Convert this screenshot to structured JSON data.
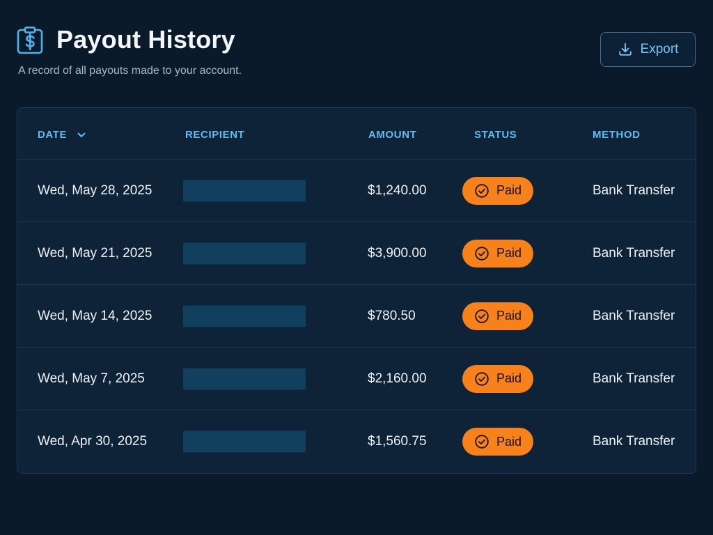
{
  "header": {
    "title": "Payout History",
    "subtitle": "A record of all payouts made to your account.",
    "icon": "payout-clipboard-dollar-icon",
    "export_label": "Export"
  },
  "table": {
    "columns": {
      "date": "DATE",
      "recipient": "RECIPIENT",
      "amount": "AMOUNT",
      "status": "STATUS",
      "method": "METHOD"
    },
    "rows": [
      {
        "date": "Wed, May 28, 2025",
        "amount": "$1,240.00",
        "status": "Paid",
        "method": "Bank Transfer"
      },
      {
        "date": "Wed, May 21, 2025",
        "amount": "$3,900.00",
        "status": "Paid",
        "method": "Bank Transfer"
      },
      {
        "date": "Wed, May 14, 2025",
        "amount": "$780.50",
        "status": "Paid",
        "method": "Bank Transfer"
      },
      {
        "date": "Wed, May 7, 2025",
        "amount": "$2,160.00",
        "status": "Paid",
        "method": "Bank Transfer"
      },
      {
        "date": "Wed, Apr 30, 2025",
        "amount": "$1,560.75",
        "status": "Paid",
        "method": "Bank Transfer"
      }
    ]
  },
  "colors": {
    "background": "#0b1a2a",
    "accent": "#5fbdf0",
    "status_paid": "#f7821b",
    "redacted": "#11405f"
  }
}
